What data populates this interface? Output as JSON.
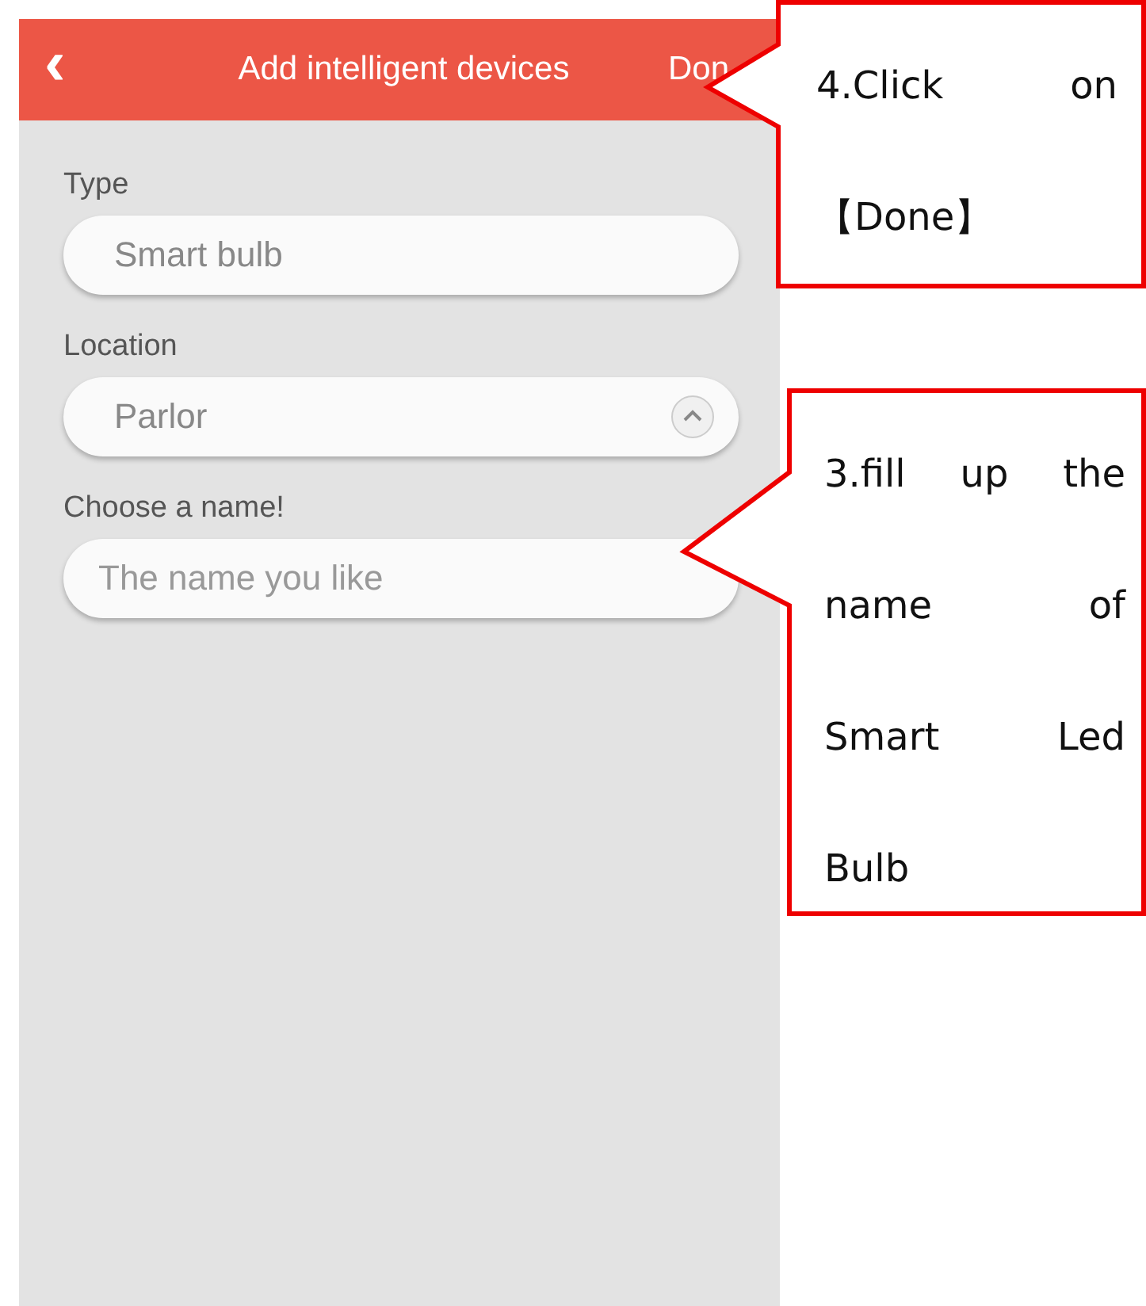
{
  "header": {
    "back": "‹",
    "title": "Add intelligent devices",
    "action": "Don"
  },
  "fields": [
    {
      "kind": "text",
      "label": "Type",
      "value": "Smart bulb"
    },
    {
      "kind": "select",
      "label": "Location",
      "value": "Parlor",
      "expanded": true
    },
    {
      "kind": "input",
      "label": "Choose a name!",
      "placeholder": "The name you like"
    }
  ],
  "callouts": [
    {
      "lines": [
        "4.Click on",
        "【Done】"
      ]
    },
    {
      "lines": [
        "3.fill up the",
        "name of",
        "Smart Led",
        "Bulb"
      ]
    }
  ]
}
